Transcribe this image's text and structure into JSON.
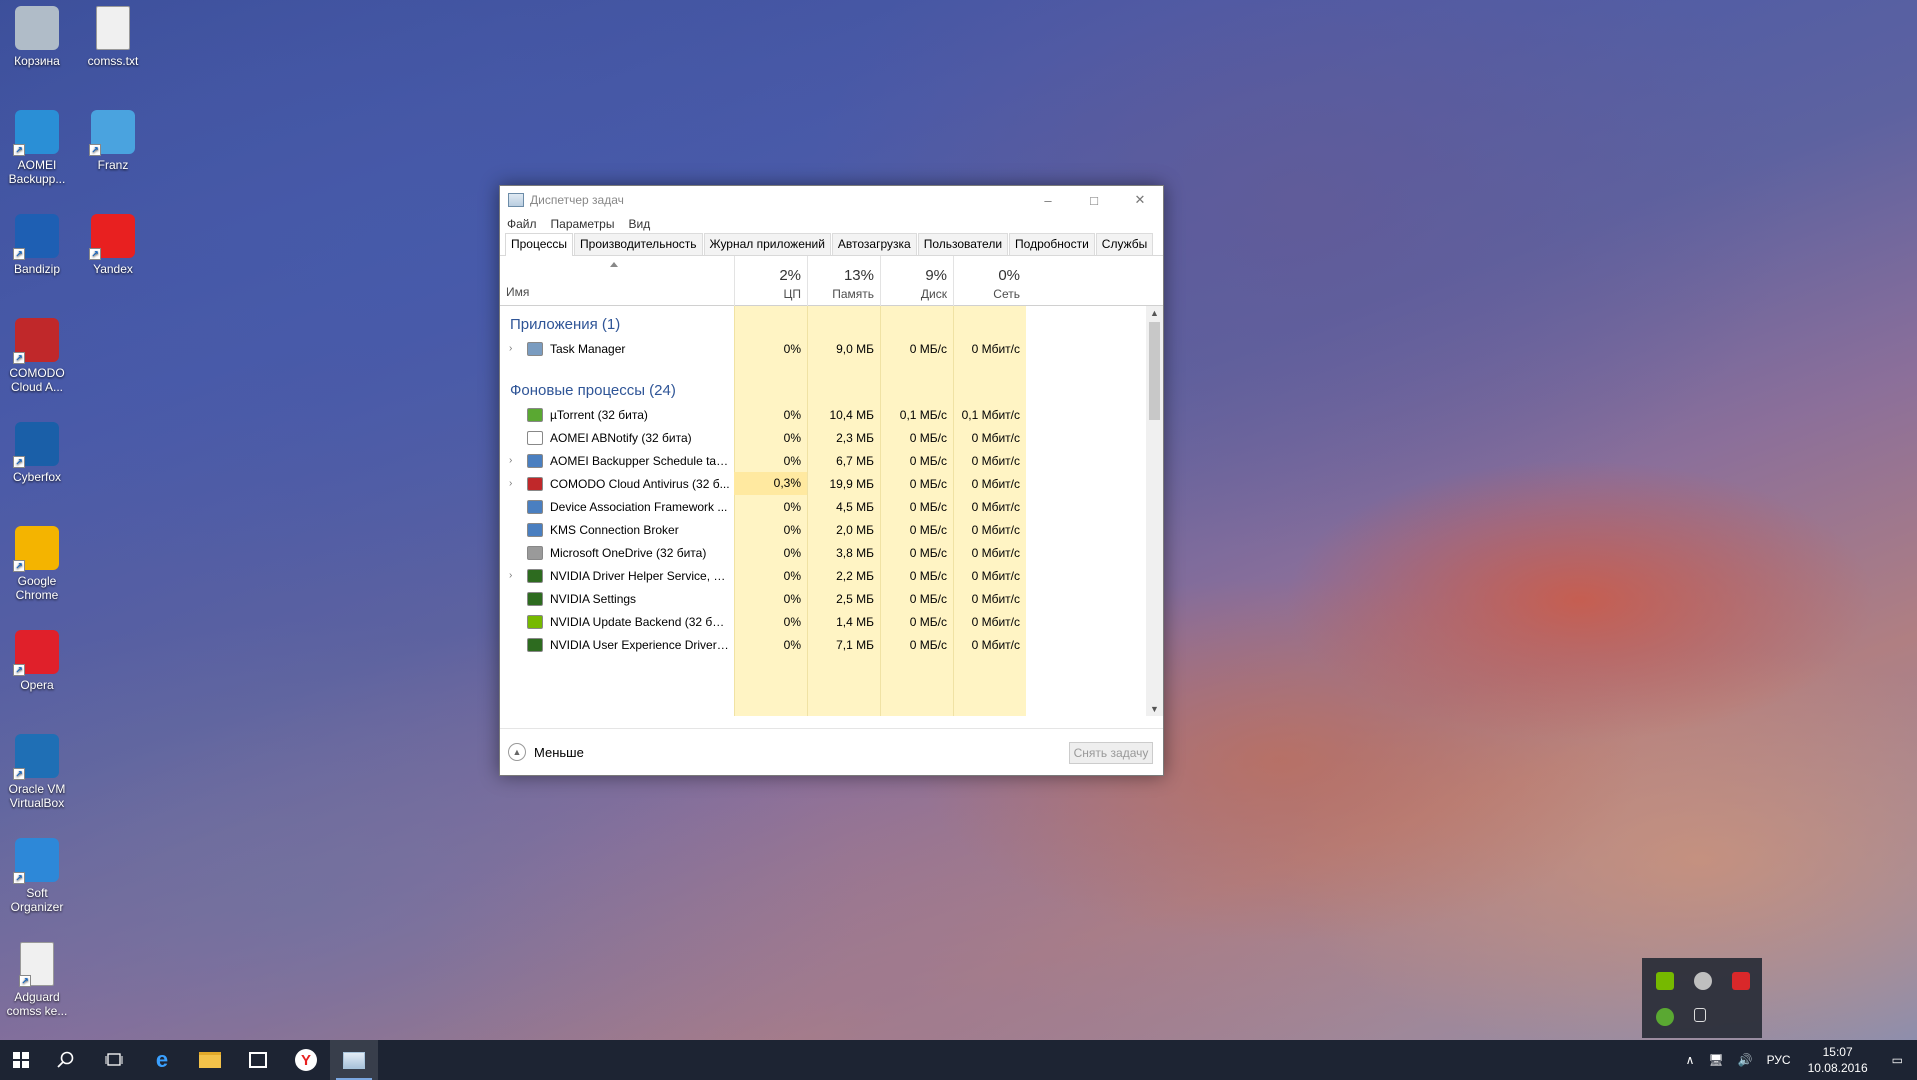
{
  "desktop": {
    "icons": [
      {
        "label": "Корзина",
        "icon": "recycle-bin-icon",
        "color": "#b0bcc8"
      },
      {
        "label": "comss.txt",
        "icon": "text-file-icon",
        "color": "#f0f0f0"
      },
      {
        "label": "AOMEI Backupp...",
        "icon": "aomei-icon",
        "color": "#2a8fd6"
      },
      {
        "label": "Franz",
        "icon": "franz-icon",
        "color": "#4aa3df"
      },
      {
        "label": "Bandizip",
        "icon": "bandizip-icon",
        "color": "#1e5fb3"
      },
      {
        "label": "Yandex",
        "icon": "yandex-icon",
        "color": "#e82020"
      },
      {
        "label": "COMODO Cloud A...",
        "icon": "comodo-icon",
        "color": "#c0282a"
      },
      {
        "label": "Cyberfox",
        "icon": "cyberfox-icon",
        "color": "#1a5fa8"
      },
      {
        "label": "Google Chrome",
        "icon": "chrome-icon",
        "color": "#f4b400"
      },
      {
        "label": "Opera",
        "icon": "opera-icon",
        "color": "#e0202a"
      },
      {
        "label": "Oracle VM VirtualBox",
        "icon": "virtualbox-icon",
        "color": "#1f6fb5"
      },
      {
        "label": "Soft Organizer",
        "icon": "soft-organizer-icon",
        "color": "#2d88d8"
      },
      {
        "label": "Adguard comss ke...",
        "icon": "text-file-icon",
        "color": "#f0f0f0"
      }
    ]
  },
  "window": {
    "title": "Диспетчер задач",
    "menu": [
      "Файл",
      "Параметры",
      "Вид"
    ],
    "tabs": [
      "Процессы",
      "Производительность",
      "Журнал приложений",
      "Автозагрузка",
      "Пользователи",
      "Подробности",
      "Службы"
    ],
    "active_tab": "Процессы",
    "columns": {
      "name": "Имя",
      "cpu": {
        "pct": "2%",
        "label": "ЦП"
      },
      "memory": {
        "pct": "13%",
        "label": "Память"
      },
      "disk": {
        "pct": "9%",
        "label": "Диск"
      },
      "network": {
        "pct": "0%",
        "label": "Сеть"
      }
    },
    "groups": {
      "apps": "Приложения (1)",
      "background": "Фоновые процессы (24)"
    },
    "app_rows": [
      {
        "name": "Task Manager",
        "cpu": "0%",
        "mem": "9,0 МБ",
        "disk": "0 МБ/с",
        "net": "0 Мбит/с",
        "expandable": true,
        "icon_color": "#7a9cc0"
      }
    ],
    "bg_rows": [
      {
        "name": "µTorrent (32 бита)",
        "cpu": "0%",
        "mem": "10,4 МБ",
        "disk": "0,1 МБ/с",
        "net": "0,1 Мбит/с",
        "expandable": false,
        "icon_color": "#5aa832"
      },
      {
        "name": "AOMEI ABNotify (32 бита)",
        "cpu": "0%",
        "mem": "2,3 МБ",
        "disk": "0 МБ/с",
        "net": "0 Мбит/с",
        "expandable": false,
        "icon_color": "#ffffff"
      },
      {
        "name": "AOMEI Backupper Schedule tas...",
        "cpu": "0%",
        "mem": "6,7 МБ",
        "disk": "0 МБ/с",
        "net": "0 Мбит/с",
        "expandable": true,
        "icon_color": "#4a7fc0"
      },
      {
        "name": "COMODO Cloud Antivirus (32 б...",
        "cpu": "0,3%",
        "mem": "19,9 МБ",
        "disk": "0 МБ/с",
        "net": "0 Мбит/с",
        "expandable": true,
        "icon_color": "#c0282a"
      },
      {
        "name": "Device Association Framework ...",
        "cpu": "0%",
        "mem": "4,5 МБ",
        "disk": "0 МБ/с",
        "net": "0 Мбит/с",
        "expandable": false,
        "icon_color": "#4a7fc0"
      },
      {
        "name": "KMS Connection Broker",
        "cpu": "0%",
        "mem": "2,0 МБ",
        "disk": "0 МБ/с",
        "net": "0 Мбит/с",
        "expandable": false,
        "icon_color": "#4a7fc0"
      },
      {
        "name": "Microsoft OneDrive (32 бита)",
        "cpu": "0%",
        "mem": "3,8 МБ",
        "disk": "0 МБ/с",
        "net": "0 Мбит/с",
        "expandable": false,
        "icon_color": "#9a9a9a"
      },
      {
        "name": "NVIDIA Driver Helper Service, Ve...",
        "cpu": "0%",
        "mem": "2,2 МБ",
        "disk": "0 МБ/с",
        "net": "0 Мбит/с",
        "expandable": true,
        "icon_color": "#2d6b1f"
      },
      {
        "name": "NVIDIA Settings",
        "cpu": "0%",
        "mem": "2,5 МБ",
        "disk": "0 МБ/с",
        "net": "0 Мбит/с",
        "expandable": false,
        "icon_color": "#2d6b1f"
      },
      {
        "name": "NVIDIA Update Backend (32 бит...",
        "cpu": "0%",
        "mem": "1,4 МБ",
        "disk": "0 МБ/с",
        "net": "0 Мбит/с",
        "expandable": false,
        "icon_color": "#76b900"
      },
      {
        "name": "NVIDIA User Experience Driver C...",
        "cpu": "0%",
        "mem": "7,1 МБ",
        "disk": "0 МБ/с",
        "net": "0 Мбит/с",
        "expandable": false,
        "icon_color": "#2d6b1f"
      }
    ],
    "footer": {
      "less": "Меньше",
      "end_task": "Снять задачу"
    }
  },
  "taskbar": {
    "lang": "РУС",
    "time": "15:07",
    "date": "10.08.2016"
  }
}
